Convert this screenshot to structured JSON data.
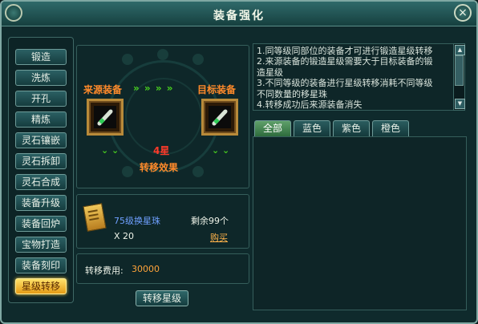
{
  "window": {
    "title": "装备强化",
    "close_label": "×"
  },
  "sidebar": {
    "items": [
      {
        "label": "锻造"
      },
      {
        "label": "洗炼"
      },
      {
        "label": "开孔"
      },
      {
        "label": "精炼"
      },
      {
        "label": "灵石镶嵌"
      },
      {
        "label": "灵石拆卸"
      },
      {
        "label": "灵石合成"
      },
      {
        "label": "装备升级"
      },
      {
        "label": "装备回炉"
      },
      {
        "label": "宝物打造"
      },
      {
        "label": "装备刻印"
      },
      {
        "label": "星级转移"
      }
    ],
    "active_index": 11
  },
  "transfer": {
    "source_label": "来源装备",
    "target_label": "目标装备",
    "arrows": "» » » »",
    "star_level": "4星",
    "effect_label": "转移效果"
  },
  "material": {
    "name": "75级换星珠",
    "quantity": "X 20",
    "remaining": "剩余99个",
    "buy_label": "购买"
  },
  "cost": {
    "label": "转移费用:",
    "value": "30000"
  },
  "transfer_button": "转移星级",
  "info_lines": [
    "1.同等级同部位的装备才可进行锻造星级转移",
    "2.来源装备的锻造星级需要大于目标装备的锻",
    "造星级",
    "3.不同等级的装备进行星级转移消耗不同等级",
    "不同数量的移星珠",
    "4.转移成功后来源装备消失"
  ],
  "tabs": [
    {
      "label": "全部"
    },
    {
      "label": "蓝色"
    },
    {
      "label": "紫色"
    },
    {
      "label": "橙色"
    }
  ],
  "colors": {
    "accent_orange": "#ff8a2a",
    "arrow_green": "#49d11f",
    "star_red": "#ff3b2a",
    "active_button": "#f2b630"
  }
}
